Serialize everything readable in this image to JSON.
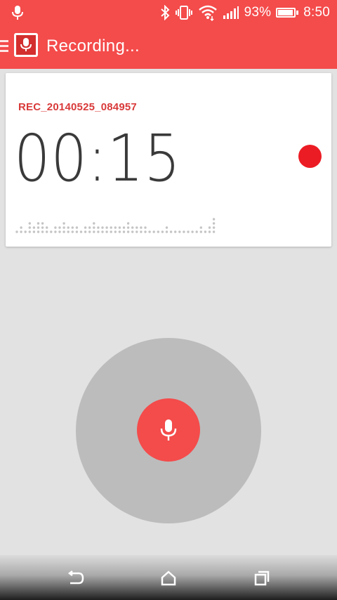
{
  "status_bar": {
    "battery_percent_text": "93%",
    "time": "8:50",
    "battery_level": 0.93,
    "icons": [
      "microphone-icon",
      "bluetooth-icon",
      "vibrate-icon",
      "wifi-icon",
      "signal-icon",
      "battery-icon"
    ]
  },
  "app_bar": {
    "title": "Recording...",
    "icons": [
      "menu-icon",
      "app-logo-microphone-icon"
    ]
  },
  "recording": {
    "file_name": "REC_20140525_084957",
    "elapsed": "00:15",
    "indicator_icon": "recording-dot-icon"
  },
  "controls": {
    "record_button_icon": "microphone-icon"
  },
  "nav_bar": {
    "icons": [
      "back-icon",
      "home-icon",
      "recent-apps-icon"
    ]
  },
  "colors": {
    "accent": "#f44b4b",
    "record_dot": "#ec1c24",
    "filename": "#d93a3a",
    "background": "#e2e2e2",
    "ring": "#bcbcbc"
  }
}
